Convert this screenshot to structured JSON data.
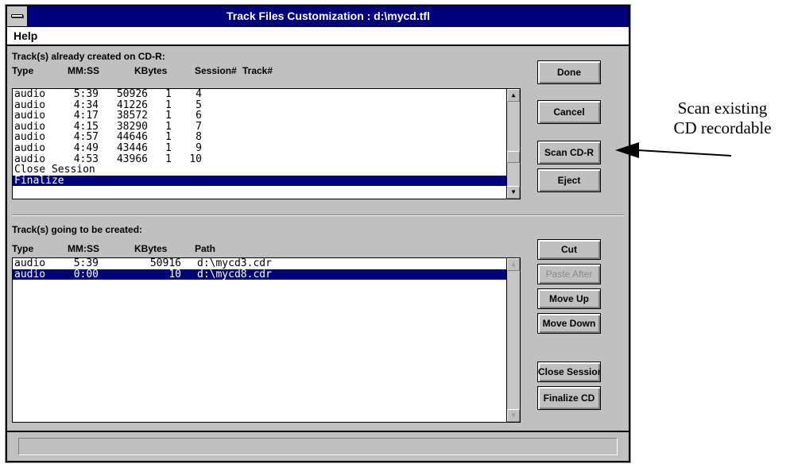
{
  "window": {
    "title": "Track Files Customization : d:\\mycd.tfl"
  },
  "menu": {
    "items": [
      "Help"
    ]
  },
  "existing": {
    "section_label": "Track(s) already created on CD-R:",
    "headers": {
      "type": "Type",
      "time": "MM:SS",
      "kbytes": "KBytes",
      "session": "Session#",
      "track": "Track#"
    },
    "rows": [
      {
        "type": "audio",
        "time": "5:39",
        "kbytes": "50926",
        "session": "1",
        "track": "4"
      },
      {
        "type": "audio",
        "time": "4:34",
        "kbytes": "41226",
        "session": "1",
        "track": "5"
      },
      {
        "type": "audio",
        "time": "4:17",
        "kbytes": "38572",
        "session": "1",
        "track": "6"
      },
      {
        "type": "audio",
        "time": "4:15",
        "kbytes": "38290",
        "session": "1",
        "track": "7"
      },
      {
        "type": "audio",
        "time": "4:57",
        "kbytes": "44646",
        "session": "1",
        "track": "8"
      },
      {
        "type": "audio",
        "time": "4:49",
        "kbytes": "43446",
        "session": "1",
        "track": "9"
      },
      {
        "type": "audio",
        "time": "4:53",
        "kbytes": "43966",
        "session": "1",
        "track": "10"
      }
    ],
    "extra_rows": [
      "Close Session",
      "Finalize"
    ]
  },
  "pending": {
    "section_label": "Track(s) going to be created:",
    "headers": {
      "type": "Type",
      "time": "MM:SS",
      "kbytes": "KBytes",
      "path": "Path"
    },
    "rows": [
      {
        "type": "audio",
        "time": "5:39",
        "kbytes": "50916",
        "path": "d:\\mycd3.cdr",
        "selected": false
      },
      {
        "type": "audio",
        "time": "0:00",
        "kbytes": "10",
        "path": "d:\\mycd8.cdr",
        "selected": true
      }
    ]
  },
  "buttons": {
    "done": "Done",
    "cancel": "Cancel",
    "scan": "Scan CD-R",
    "eject": "Eject",
    "cut": "Cut",
    "paste_after": "Paste After",
    "move_up": "Move Up",
    "move_down": "Move Down",
    "close_session": "Close Session",
    "finalize": "Finalize CD"
  },
  "annotation": {
    "line1": "Scan existing",
    "line2": "CD recordable"
  },
  "icons": {
    "scroll_up": "arrow-up-icon",
    "scroll_down": "arrow-down-icon",
    "system_menu": "system-menu-icon",
    "annotation": "arrow-left-icon"
  },
  "colors": {
    "titlebar": "#00007c",
    "selection": "#00007c",
    "dialog_face": "#c0c0c0"
  }
}
